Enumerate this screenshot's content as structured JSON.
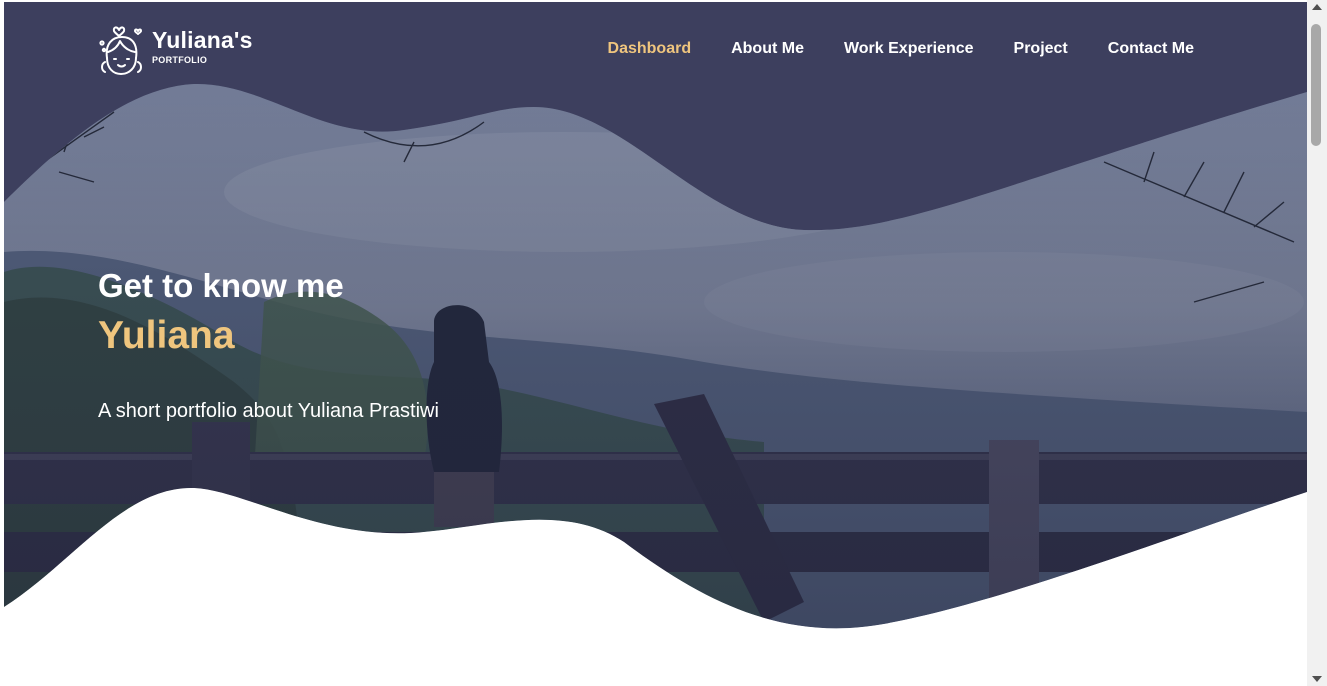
{
  "brand": {
    "name": "Yuliana's",
    "subtitle": "PORTFOLIO",
    "logo_icon": "girl-face-with-hearts-icon"
  },
  "nav": {
    "items": [
      {
        "label": "Dashboard",
        "active": true
      },
      {
        "label": "About Me",
        "active": false
      },
      {
        "label": "Work Experience",
        "active": false
      },
      {
        "label": "Project",
        "active": false
      },
      {
        "label": "Contact Me",
        "active": false
      }
    ]
  },
  "hero": {
    "kicker": "Get to know me",
    "name": "Yuliana",
    "tagline": "A short portfolio about Yuliana Prastiwi",
    "background_image": "misty-mountain-overlook-photo"
  },
  "colors": {
    "navy": "#3d3f5e",
    "accent": "#efc57e",
    "text": "#ffffff"
  }
}
